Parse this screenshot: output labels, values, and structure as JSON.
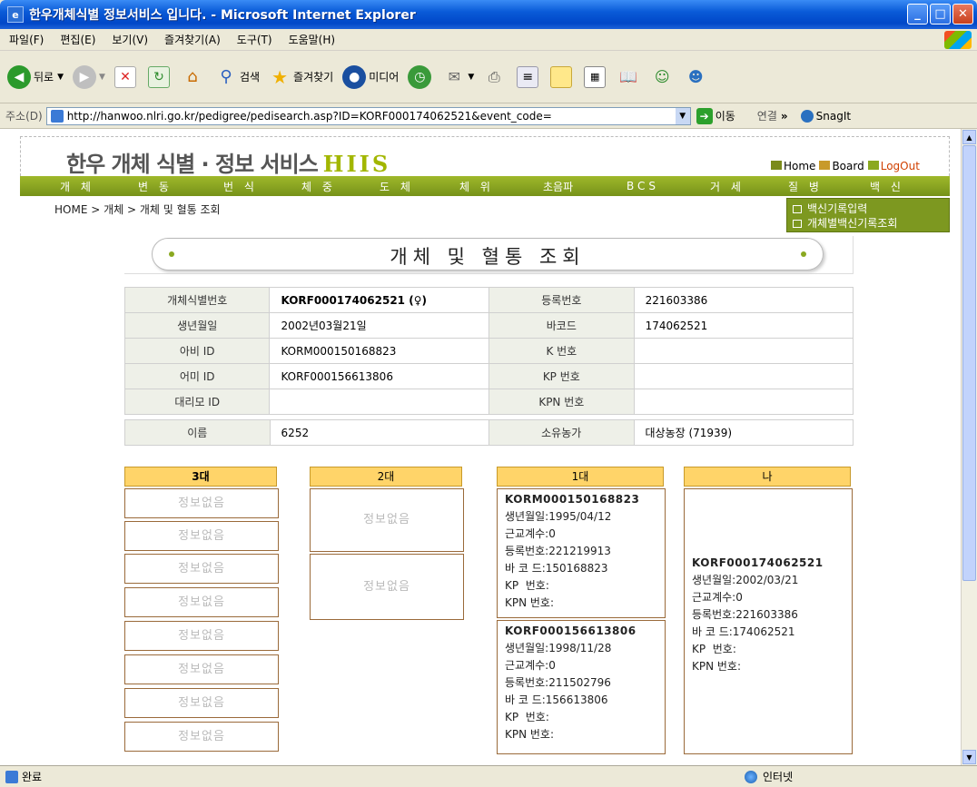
{
  "window": {
    "title": "한우개체식별 정보서비스 입니다. - Microsoft Internet Explorer"
  },
  "menu": [
    "파일(F)",
    "편집(E)",
    "보기(V)",
    "즐겨찾기(A)",
    "도구(T)",
    "도움말(H)"
  ],
  "toolbar": {
    "back": "뒤로",
    "search": "검색",
    "favorites": "즐겨찾기",
    "media": "미디어"
  },
  "address": {
    "label": "주소(D)",
    "url": "http://hanwoo.nlri.go.kr/pedigree/pedisearch.asp?ID=KORF000174062521&event_code=",
    "go": "이동",
    "links": "연결",
    "snagit": "SnagIt"
  },
  "site": {
    "logo": "한우 개체 식별 · 정보 서비스",
    "logo_en": "HIIS",
    "home": "Home",
    "board": "Board",
    "logout": "LogOut"
  },
  "nav": [
    "개 체",
    "변 동",
    "번 식",
    "체 중",
    "도 체",
    "체 위",
    "초음파",
    "BCS",
    "거 세",
    "질 병",
    "백 신"
  ],
  "breadcrumb": "HOME > 개체 > 개체 및 혈통 조회",
  "submenu": [
    "백신기록입력",
    "개체별백신기록조회"
  ],
  "page_title": "개체 및 혈통 조회",
  "info": {
    "rows": [
      [
        "개체식별번호",
        "KORF000174062521 (♀)",
        "등록번호",
        "221603386"
      ],
      [
        "생년월일",
        "2002년03월21일",
        "바코드",
        "174062521"
      ],
      [
        "아비 ID",
        "KORM000150168823",
        "K 번호",
        ""
      ],
      [
        "어미 ID",
        "KORF000156613806",
        "KP 번호",
        ""
      ],
      [
        "대리모 ID",
        "",
        "KPN 번호",
        ""
      ]
    ],
    "name_row": [
      "이름",
      "6252",
      "소유농가",
      "대상농장 (71939)"
    ]
  },
  "pedigree": {
    "headers": [
      "3대",
      "2대",
      "1대",
      "나"
    ],
    "empty": "정보없음",
    "father": {
      "id": "KORM000150168823",
      "lines": [
        "생년월일:1995/04/12",
        "근교계수:0",
        "등록번호:221219913",
        "바 코 드:150168823",
        "KP  번호:",
        "KPN 번호:"
      ]
    },
    "mother": {
      "id": "KORF000156613806",
      "lines": [
        "생년월일:1998/11/28",
        "근교계수:0",
        "등록번호:211502796",
        "바 코 드:156613806",
        "KP  번호:",
        "KPN 번호:"
      ]
    },
    "self": {
      "id": "KORF000174062521",
      "lines": [
        "생년월일:2002/03/21",
        "근교계수:0",
        "등록번호:221603386",
        "바 코 드:174062521",
        "KP  번호:",
        "KPN 번호:"
      ]
    }
  },
  "status": {
    "left": "완료",
    "zone": "인터넷"
  }
}
